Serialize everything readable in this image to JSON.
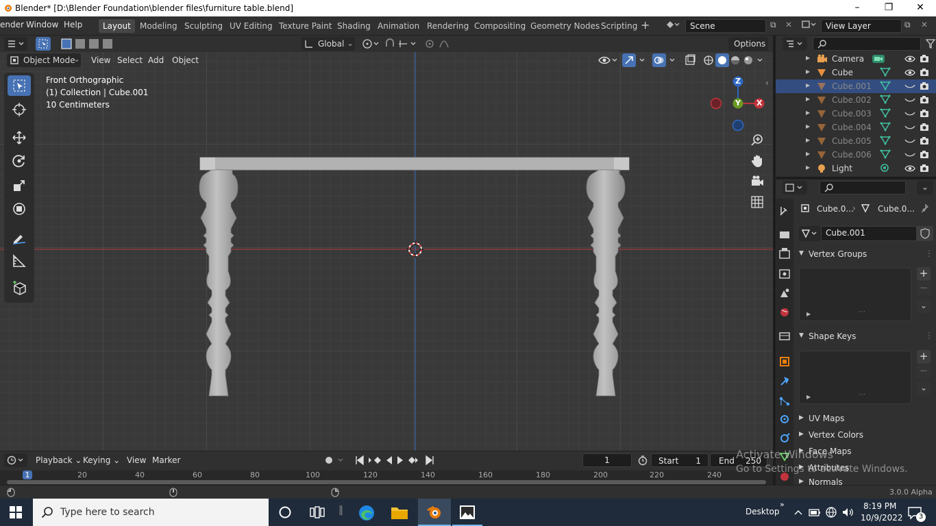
{
  "window": {
    "title": "Blender* [D:\\Blender Foundation\\blender files\\furniture table.blend]"
  },
  "menus": [
    "ender",
    "Window",
    "Help"
  ],
  "workspaces": [
    "Layout",
    "Modeling",
    "Sculpting",
    "UV Editing",
    "Texture Paint",
    "Shading",
    "Animation",
    "Rendering",
    "Compositing",
    "Geometry Nodes",
    "Scripting"
  ],
  "active_workspace": "Layout",
  "scene": {
    "label": "Scene",
    "view_layer": "View Layer"
  },
  "toolbar": {
    "orientation": "Global",
    "options": "Options"
  },
  "viewport_header": {
    "mode": "Object Mode",
    "view": "View",
    "select": "Select",
    "add": "Add",
    "object": "Object"
  },
  "viewport_overlay": {
    "line1": "Front Orthographic",
    "line2": "(1) Collection | Cube.001",
    "line3": "10 Centimeters"
  },
  "gizmo": {
    "z": "Z",
    "y": "Y",
    "x": "X"
  },
  "outliner": {
    "items": [
      {
        "name": "Camera",
        "type": "camera",
        "dim": false,
        "selected": false
      },
      {
        "name": "Cube",
        "type": "mesh",
        "dim": false,
        "selected": false
      },
      {
        "name": "Cube.001",
        "type": "mesh",
        "dim": true,
        "selected": true
      },
      {
        "name": "Cube.002",
        "type": "mesh",
        "dim": true,
        "selected": false
      },
      {
        "name": "Cube.003",
        "type": "mesh",
        "dim": true,
        "selected": false
      },
      {
        "name": "Cube.004",
        "type": "mesh",
        "dim": true,
        "selected": false
      },
      {
        "name": "Cube.005",
        "type": "mesh",
        "dim": true,
        "selected": false
      },
      {
        "name": "Cube.006",
        "type": "mesh",
        "dim": true,
        "selected": false
      },
      {
        "name": "Light",
        "type": "light",
        "dim": false,
        "selected": false
      }
    ]
  },
  "properties": {
    "breadcrumb_object": "Cube.0...",
    "breadcrumb_mesh": "Cube.0...",
    "mesh_name": "Cube.001",
    "panels": {
      "vertex_groups": "Vertex Groups",
      "shape_keys": "Shape Keys",
      "uv_maps": "UV Maps",
      "vertex_colors": "Vertex Colors",
      "face_maps": "Face Maps",
      "attributes": "Attributes",
      "normals": "Normals"
    }
  },
  "timeline": {
    "playback": "Playback",
    "keying": "Keying",
    "view": "View",
    "marker": "Marker",
    "current_frame": "1",
    "start_label": "Start",
    "start": "1",
    "end_label": "End",
    "end": "250",
    "ruler": [
      "1",
      "20",
      "40",
      "60",
      "80",
      "100",
      "120",
      "140",
      "160",
      "180",
      "200",
      "220",
      "240"
    ]
  },
  "watermark": {
    "line1": "Activate Windows",
    "line2": "Go to Settings to activate Windows."
  },
  "status": {
    "version": "3.0.0 Alpha"
  },
  "taskbar": {
    "search_placeholder": "Type here to search",
    "desktop": "Desktop",
    "time": "8:19 PM",
    "date": "10/9/2022",
    "notifications": "3"
  },
  "colors": {
    "accent": "#4772b3",
    "x_axis": "#c0343d",
    "y_axis": "#6a9a23",
    "z_axis": "#2f68c0",
    "selected_row": "#334d80"
  }
}
